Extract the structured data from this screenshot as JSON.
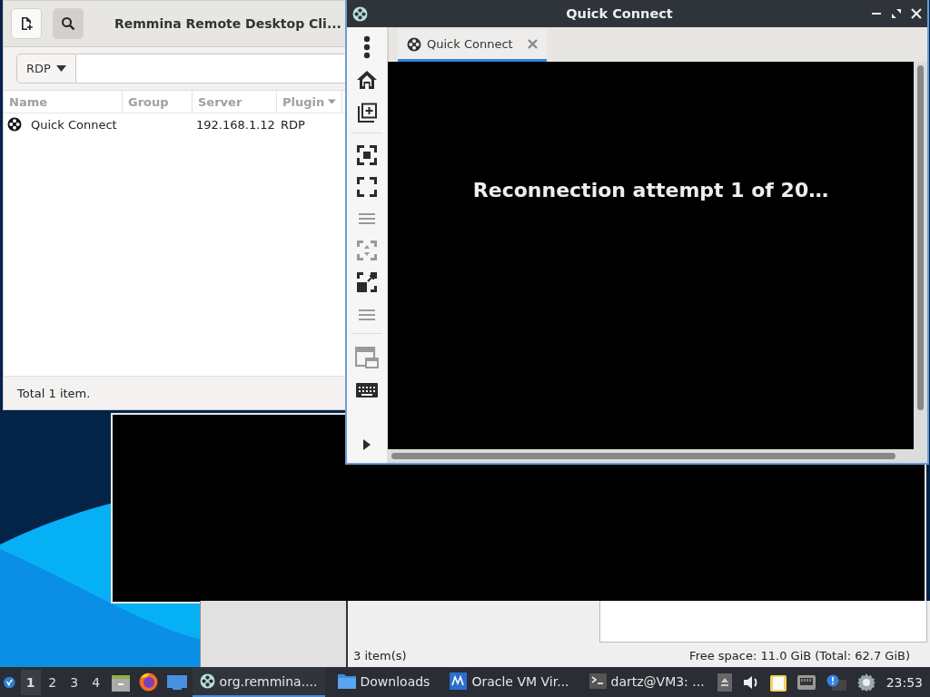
{
  "main_window": {
    "title": "Remmina Remote Desktop Cli...",
    "protocol": "RDP",
    "columns": [
      {
        "label": "Name",
        "sorted": false
      },
      {
        "label": "Group",
        "sorted": false
      },
      {
        "label": "Server",
        "sorted": false
      },
      {
        "label": "Plugin",
        "sorted": true
      }
    ],
    "rows": [
      {
        "name": "Quick Connect",
        "server": "192.168.1.12",
        "plugin": "RDP"
      }
    ],
    "status": "Total 1 item."
  },
  "connection_window": {
    "title": "Quick Connect",
    "tools": [
      {
        "disabled": false
      },
      {
        "disabled": false
      },
      {
        "disabled": false
      },
      {
        "disabled": false
      },
      {
        "disabled": false
      },
      {
        "disabled": true
      },
      {
        "disabled": true
      },
      {
        "disabled": false
      },
      {
        "disabled": true
      },
      {
        "disabled": true
      },
      {
        "disabled": false
      },
      {
        "disabled": false
      }
    ],
    "tabs": [
      {
        "label": "Quick Connect",
        "selected": true
      }
    ],
    "message": "Reconnection attempt 1 of 20…"
  },
  "file_manager": {
    "item_count": "3 item(s)",
    "free_space": "Free space: 11.0 GiB (Total: 62.7 GiB)"
  },
  "taskbar": {
    "workspaces": [
      {
        "label": "1",
        "selected": true
      },
      {
        "label": "2",
        "selected": false
      },
      {
        "label": "3",
        "selected": false
      },
      {
        "label": "4",
        "selected": false
      }
    ],
    "tasks": [
      {
        "label": "org.remmina....",
        "selected": true
      },
      {
        "label": "Downloads",
        "selected": false
      },
      {
        "label": "Oracle VM Vir...",
        "selected": false
      },
      {
        "label": "dartz@VM3: ...",
        "selected": false
      }
    ],
    "clock": "23:53"
  }
}
